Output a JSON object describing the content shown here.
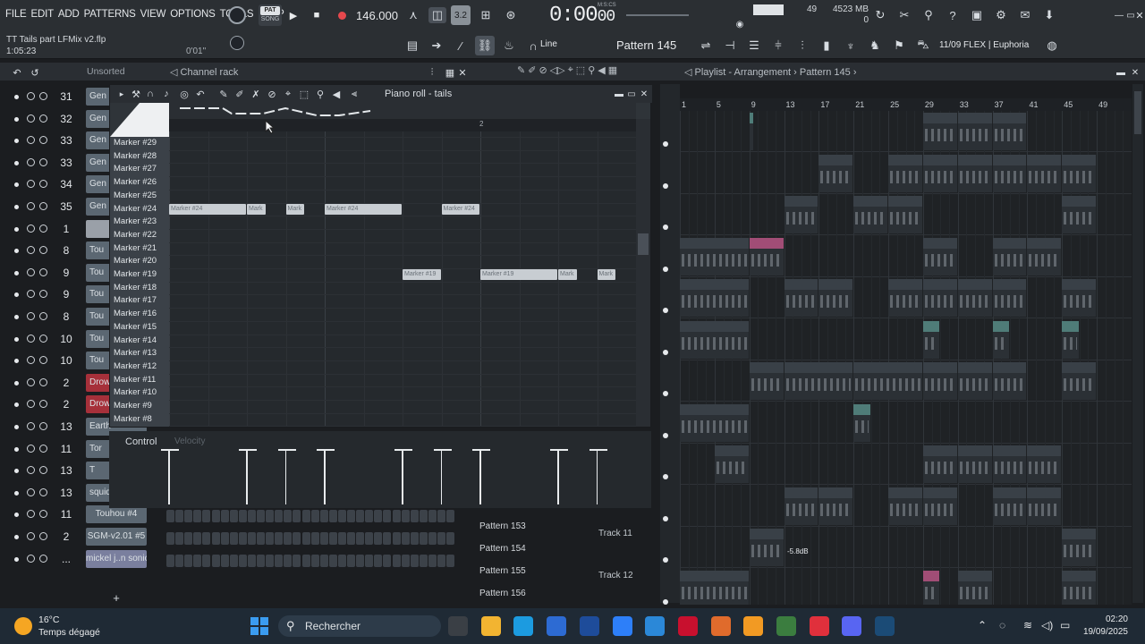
{
  "menu": [
    "FILE",
    "EDIT",
    "ADD",
    "PATTERNS",
    "VIEW",
    "OPTIONS",
    "TOOLS",
    "HELP"
  ],
  "project": {
    "name": "TT Tails part LFMix v2.flp",
    "time": "1:05:23",
    "hint": "0'01\""
  },
  "transport": {
    "mode_top": "PAT",
    "mode_bottom": "SONG",
    "tempo": "146.000",
    "time": "0:00",
    "time_fraction": "00",
    "time_unit": "M:S:CS",
    "snap_value": "3.2"
  },
  "perf": {
    "cpu": "49",
    "memory": "4523 MB",
    "polyphony": "0"
  },
  "toolbar": {
    "snap": "Line",
    "pattern": "Pattern 145",
    "hint": "11/09  FLEX | Euphoria"
  },
  "channel_rack": {
    "title": "Channel rack",
    "filter": "Unsorted",
    "channels": [
      {
        "num": "31",
        "name": "Gen",
        "color": "#5b6772"
      },
      {
        "num": "32",
        "name": "Gen",
        "color": "#5b6772"
      },
      {
        "num": "33",
        "name": "Gen",
        "color": "#5b6772"
      },
      {
        "num": "33",
        "name": "Gen",
        "color": "#5b6772"
      },
      {
        "num": "34",
        "name": "Gen",
        "color": "#5b6772"
      },
      {
        "num": "35",
        "name": "Gen",
        "color": "#5b6772"
      },
      {
        "num": "1",
        "name": "",
        "color": "#9aa0a8"
      },
      {
        "num": "8",
        "name": "Tou",
        "color": "#5b6772"
      },
      {
        "num": "9",
        "name": "Tou",
        "color": "#5b6772"
      },
      {
        "num": "9",
        "name": "Tou",
        "color": "#5b6772"
      },
      {
        "num": "8",
        "name": "Tou",
        "color": "#5b6772"
      },
      {
        "num": "10",
        "name": "Tou",
        "color": "#5b6772"
      },
      {
        "num": "10",
        "name": "Tou",
        "color": "#5b6772"
      },
      {
        "num": "2",
        "name": "Drow",
        "color": "#a6303a"
      },
      {
        "num": "2",
        "name": "Drown",
        "color": "#a6303a"
      },
      {
        "num": "13",
        "name": "Earth",
        "color": "#5b6772"
      },
      {
        "num": "11",
        "name": "Tor",
        "color": "#5b6772"
      },
      {
        "num": "13",
        "name": "T",
        "color": "#5b6772"
      },
      {
        "num": "13",
        "name": "squid",
        "color": "#5b6772"
      },
      {
        "num": "11",
        "name": "Touhou #4",
        "color": "#5b6772"
      },
      {
        "num": "2",
        "name": "SGM-v2.01 #5",
        "color": "#5b6772"
      },
      {
        "num": "...",
        "name": "mickel j..n sonic",
        "color": "#7a7f9e"
      }
    ]
  },
  "piano_roll": {
    "title": "Piano roll - tails",
    "ruler_mark": "2",
    "markers": [
      "Marker #29",
      "Marker #28",
      "Marker #27",
      "Marker #26",
      "Marker #25",
      "Marker #24",
      "Marker #23",
      "Marker #22",
      "Marker #21",
      "Marker #20",
      "Marker #19",
      "Marker #18",
      "Marker #17",
      "Marker #16",
      "Marker #15",
      "Marker #14",
      "Marker #13",
      "Marker #12",
      "Marker #11",
      "Marker #10",
      "Marker #9",
      "Marker #8"
    ],
    "notes": [
      {
        "label": "Marker #24",
        "row": "Marker #24",
        "start": 0,
        "len": 2.0
      },
      {
        "label": "Mark",
        "row": "Marker #24",
        "start": 2.0,
        "len": 0.5
      },
      {
        "label": "Mark",
        "row": "Marker #24",
        "start": 3.0,
        "len": 0.5
      },
      {
        "label": "Marker #24",
        "row": "Marker #24",
        "start": 4.0,
        "len": 2.0
      },
      {
        "label": "Marker #24",
        "row": "Marker #24",
        "start": 7.0,
        "len": 1.0
      },
      {
        "label": "Marker #19",
        "row": "Marker #19",
        "start": 6.0,
        "len": 1.0
      },
      {
        "label": "Marker #19",
        "row": "Marker #19",
        "start": 8.0,
        "len": 2.0
      },
      {
        "label": "Mark",
        "row": "Marker #19",
        "start": 10.0,
        "len": 0.5
      },
      {
        "label": "Mark",
        "row": "Marker #19",
        "start": 11.0,
        "len": 0.5
      }
    ],
    "control_label": "Control",
    "velocity_label": "Velocity"
  },
  "pattern_list": [
    "Pattern 153",
    "Pattern 154",
    "Pattern 155",
    "Pattern 156"
  ],
  "track_labels": [
    "Track 11",
    "Track 12"
  ],
  "playlist": {
    "title": "Playlist - Arrangement",
    "pattern": "Pattern 145",
    "ruler": [
      "1",
      "5",
      "9",
      "13",
      "17",
      "21",
      "25",
      "29",
      "33",
      "37",
      "41",
      "45",
      "49"
    ],
    "clips": [
      {
        "lane": 0,
        "start": 29,
        "len": 4,
        "label": "Pa..n 2",
        "kind": ""
      },
      {
        "lane": 0,
        "start": 33,
        "len": 4,
        "label": "Pat..60",
        "kind": ""
      },
      {
        "lane": 0,
        "start": 37,
        "len": 4,
        "label": "Pattern 3",
        "kind": ""
      },
      {
        "lane": 0,
        "start": 9,
        "len": 0.5,
        "label": "",
        "kind": "accent"
      },
      {
        "lane": 1,
        "start": 17,
        "len": 4,
        "label": "Patt..164",
        "kind": ""
      },
      {
        "lane": 1,
        "start": 25,
        "len": 4,
        "label": "Pa..n 6",
        "kind": ""
      },
      {
        "lane": 1,
        "start": 29,
        "len": 4,
        "label": "Pat..59",
        "kind": ""
      },
      {
        "lane": 1,
        "start": 33,
        "len": 4,
        "label": "Pa..n 7",
        "kind": ""
      },
      {
        "lane": 1,
        "start": 37,
        "len": 4,
        "label": "Pat..61",
        "kind": ""
      },
      {
        "lane": 1,
        "start": 41,
        "len": 4,
        "label": "Pa..n 8",
        "kind": ""
      },
      {
        "lane": 1,
        "start": 45,
        "len": 4,
        "label": "Pat..23",
        "kind": ""
      },
      {
        "lane": 2,
        "start": 13,
        "len": 4,
        "label": "Pat..163",
        "kind": ""
      },
      {
        "lane": 2,
        "start": 21,
        "len": 4,
        "label": "Pat..44",
        "kind": ""
      },
      {
        "lane": 2,
        "start": 25,
        "len": 4,
        "label": "Pa..5",
        "kind": ""
      },
      {
        "lane": 2,
        "start": 45,
        "len": 4,
        "label": "Pat..50",
        "kind": ""
      },
      {
        "lane": 3,
        "start": 1,
        "len": 8,
        "label": "Pattern 156",
        "kind": ""
      },
      {
        "lane": 3,
        "start": 9,
        "len": 4,
        "label": "5..16",
        "kind": "pink"
      },
      {
        "lane": 3,
        "start": 29,
        "len": 4,
        "label": "ev..2",
        "kind": ""
      },
      {
        "lane": 3,
        "start": 37,
        "len": 4,
        "label": "Pat..71",
        "kind": ""
      },
      {
        "lane": 3,
        "start": 41,
        "len": 4,
        "label": "Pa..1",
        "kind": ""
      },
      {
        "lane": 4,
        "start": 1,
        "len": 8,
        "label": "Pattern 158",
        "kind": ""
      },
      {
        "lane": 4,
        "start": 13,
        "len": 4,
        "label": "Pat..69",
        "kind": ""
      },
      {
        "lane": 4,
        "start": 17,
        "len": 4,
        "label": "Pat..69",
        "kind": ""
      },
      {
        "lane": 4,
        "start": 25,
        "len": 4,
        "label": "Pat..11",
        "kind": ""
      },
      {
        "lane": 4,
        "start": 29,
        "len": 4,
        "label": "Pat..46",
        "kind": ""
      },
      {
        "lane": 4,
        "start": 33,
        "len": 4,
        "label": "Pa..46",
        "kind": ""
      },
      {
        "lane": 4,
        "start": 37,
        "len": 4,
        "label": "Pat..46",
        "kind": ""
      },
      {
        "lane": 4,
        "start": 45,
        "len": 4,
        "label": "Pat..69",
        "kind": ""
      },
      {
        "lane": 5,
        "start": 1,
        "len": 8,
        "label": "06_-_..YM3",
        "kind": ""
      },
      {
        "lane": 5,
        "start": 29,
        "len": 2,
        "label": "",
        "kind": "accent"
      },
      {
        "lane": 5,
        "start": 37,
        "len": 2,
        "label": "",
        "kind": "accent"
      },
      {
        "lane": 5,
        "start": 45,
        "len": 2,
        "label": "",
        "kind": "accent"
      },
      {
        "lane": 6,
        "start": 9,
        "len": 4,
        "label": "ev..2",
        "kind": ""
      },
      {
        "lane": 6,
        "start": 13,
        "len": 8,
        "label": "Pattern 165",
        "kind": ""
      },
      {
        "lane": 6,
        "start": 21,
        "len": 8,
        "label": "Pattern 14",
        "kind": ""
      },
      {
        "lane": 6,
        "start": 29,
        "len": 4,
        "label": "Pat..15",
        "kind": ""
      },
      {
        "lane": 6,
        "start": 33,
        "len": 4,
        "label": "Pat..15",
        "kind": ""
      },
      {
        "lane": 6,
        "start": 37,
        "len": 4,
        "label": "Pat..15",
        "kind": ""
      },
      {
        "lane": 6,
        "start": 45,
        "len": 4,
        "label": "Pattern 149",
        "kind": ""
      },
      {
        "lane": 7,
        "start": 1,
        "len": 8,
        "label": "Pattern 155",
        "kind": ""
      },
      {
        "lane": 7,
        "start": 21,
        "len": 2,
        "label": "",
        "kind": "accent"
      },
      {
        "lane": 8,
        "start": 5,
        "len": 4,
        "label": "Pat..154",
        "kind": ""
      },
      {
        "lane": 8,
        "start": 29,
        "len": 4,
        "label": "Pat..7",
        "kind": ""
      },
      {
        "lane": 8,
        "start": 33,
        "len": 4,
        "label": "Pat..46",
        "kind": ""
      },
      {
        "lane": 8,
        "start": 37,
        "len": 4,
        "label": "Pat..6",
        "kind": ""
      },
      {
        "lane": 8,
        "start": 41,
        "len": 4,
        "label": "Pat..46",
        "kind": ""
      },
      {
        "lane": 9,
        "start": 13,
        "len": 4,
        "label": "Pat..48",
        "kind": ""
      },
      {
        "lane": 9,
        "start": 17,
        "len": 4,
        "label": "Pat..48",
        "kind": ""
      },
      {
        "lane": 9,
        "start": 25,
        "len": 4,
        "label": "Pat..48",
        "kind": ""
      },
      {
        "lane": 9,
        "start": 29,
        "len": 4,
        "label": "Pat..48",
        "kind": ""
      },
      {
        "lane": 9,
        "start": 37,
        "len": 4,
        "label": "Pat..48",
        "kind": ""
      },
      {
        "lane": 9,
        "start": 41,
        "len": 4,
        "label": "Pat..48",
        "kind": ""
      },
      {
        "lane": 10,
        "start": 9,
        "len": 4,
        "label": "ev..2",
        "kind": ""
      },
      {
        "lane": 10,
        "start": 45,
        "len": 4,
        "label": "Effect..Param X",
        "kind": ""
      },
      {
        "lane": 11,
        "start": 1,
        "len": 8,
        "label": "Distruct..er Cutoff",
        "kind": ""
      },
      {
        "lane": 11,
        "start": 29,
        "len": 2,
        "label": "",
        "kind": "pink"
      },
      {
        "lane": 11,
        "start": 33,
        "len": 4,
        "label": "ev..2",
        "kind": ""
      },
      {
        "lane": 11,
        "start": 45,
        "len": 4,
        "label": "Pat..28",
        "kind": ""
      }
    ],
    "gain_label": "-5.8dB"
  },
  "taskbar": {
    "temperature": "16°C",
    "weather": "Temps dégagé",
    "search_placeholder": "Rechercher",
    "time": "02:20",
    "date": "19/09/2025",
    "apps": [
      {
        "name": "task-view",
        "color": "#3a3f45"
      },
      {
        "name": "file-explorer",
        "color": "#f2b431"
      },
      {
        "name": "edge",
        "color": "#1c9be0"
      },
      {
        "name": "store",
        "color": "#2d6bd3"
      },
      {
        "name": "b-app",
        "color": "#1e4c9a"
      },
      {
        "name": "dropbox",
        "color": "#2d7ff9"
      },
      {
        "name": "mail",
        "color": "#2b88d8"
      },
      {
        "name": "mcafee",
        "color": "#c8102e"
      },
      {
        "name": "calendar",
        "color": "#e06b2c"
      },
      {
        "name": "fl-studio",
        "color": "#f29a23"
      },
      {
        "name": "chrome",
        "color": "#3b7d3f"
      },
      {
        "name": "opera",
        "color": "#e0303c"
      },
      {
        "name": "discord",
        "color": "#5865f2"
      },
      {
        "name": "steam",
        "color": "#1b4b76"
      }
    ]
  }
}
